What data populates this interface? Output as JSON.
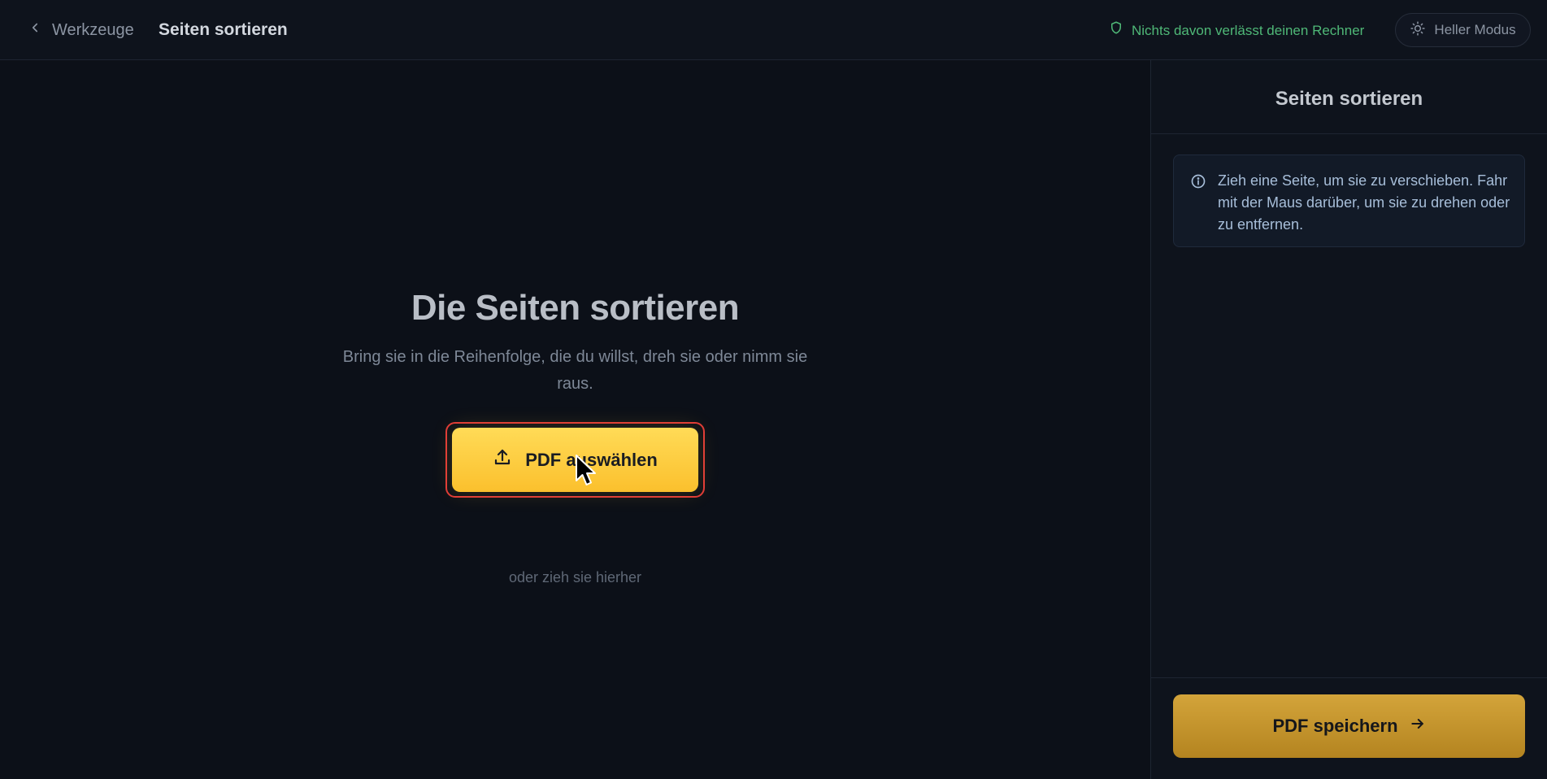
{
  "header": {
    "back_label": "Werkzeuge",
    "title": "Seiten sortieren",
    "privacy_note": "Nichts davon verlässt deinen Rechner",
    "mode_toggle_label": "Heller Modus"
  },
  "main": {
    "heading": "Die Seiten sortieren",
    "subtitle": "Bring sie in die Reihenfolge, die du willst, dreh sie oder nimm sie raus.",
    "upload_button_label": "PDF auswählen",
    "drop_hint": "oder zieh sie hierher"
  },
  "sidebar": {
    "title": "Seiten sortieren",
    "info_text": "Zieh eine Seite, um sie zu verschieben. Fahr mit der Maus darüber, um sie zu drehen oder zu entfernen.",
    "save_button_label": "PDF speichern"
  },
  "icons": {
    "back": "chevron-left-icon",
    "privacy": "shield-icon",
    "mode": "sun-icon",
    "upload": "upload-icon",
    "info": "info-icon",
    "save": "arrow-right-icon"
  },
  "colors": {
    "background": "#0c1018",
    "accent_yellow": "#fbc02d",
    "privacy_green": "#4fb877",
    "highlight_red": "#e03a38",
    "save_gold": "#c6972d"
  }
}
